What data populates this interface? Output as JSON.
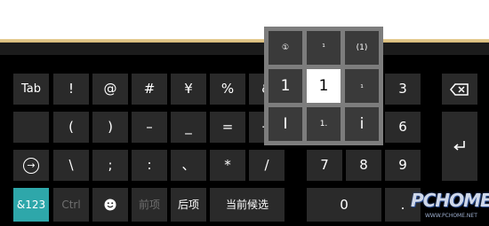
{
  "keyboard": {
    "row1": {
      "tab": "Tab",
      "k1": "!",
      "k2": "@",
      "k3": "#",
      "k4": "¥",
      "k5": "%",
      "k6": "&",
      "n3": "3"
    },
    "row2": {
      "k1": "(",
      "k2": ")",
      "k3": "–",
      "k4": "_",
      "k5": "=",
      "k6": "+",
      "n6": "6"
    },
    "row3": {
      "k1": "\\",
      "k2": ";",
      "k3": ":",
      "k4": "、",
      "k5": "*",
      "k6": "/",
      "n7": "7",
      "n8": "8",
      "n9": "9"
    },
    "row4": {
      "sym": "&123",
      "ctrl": "Ctrl",
      "prev": "前项",
      "next": "后项",
      "current": "当前候选",
      "n0": "0",
      "dot": "."
    }
  },
  "popup": {
    "r1": [
      "①",
      "¹",
      "(1)"
    ],
    "r2": [
      "1",
      "1",
      "₁"
    ],
    "r3": [
      "I",
      "1.",
      "i"
    ],
    "selected_index": 4
  },
  "watermark": {
    "brand": "PCHOME",
    "url": "WWW.PCHOME.NET"
  },
  "colors": {
    "key_bg": "#2a2a2a",
    "accent": "#2ea7aa",
    "top_accent": "#e2c888"
  }
}
